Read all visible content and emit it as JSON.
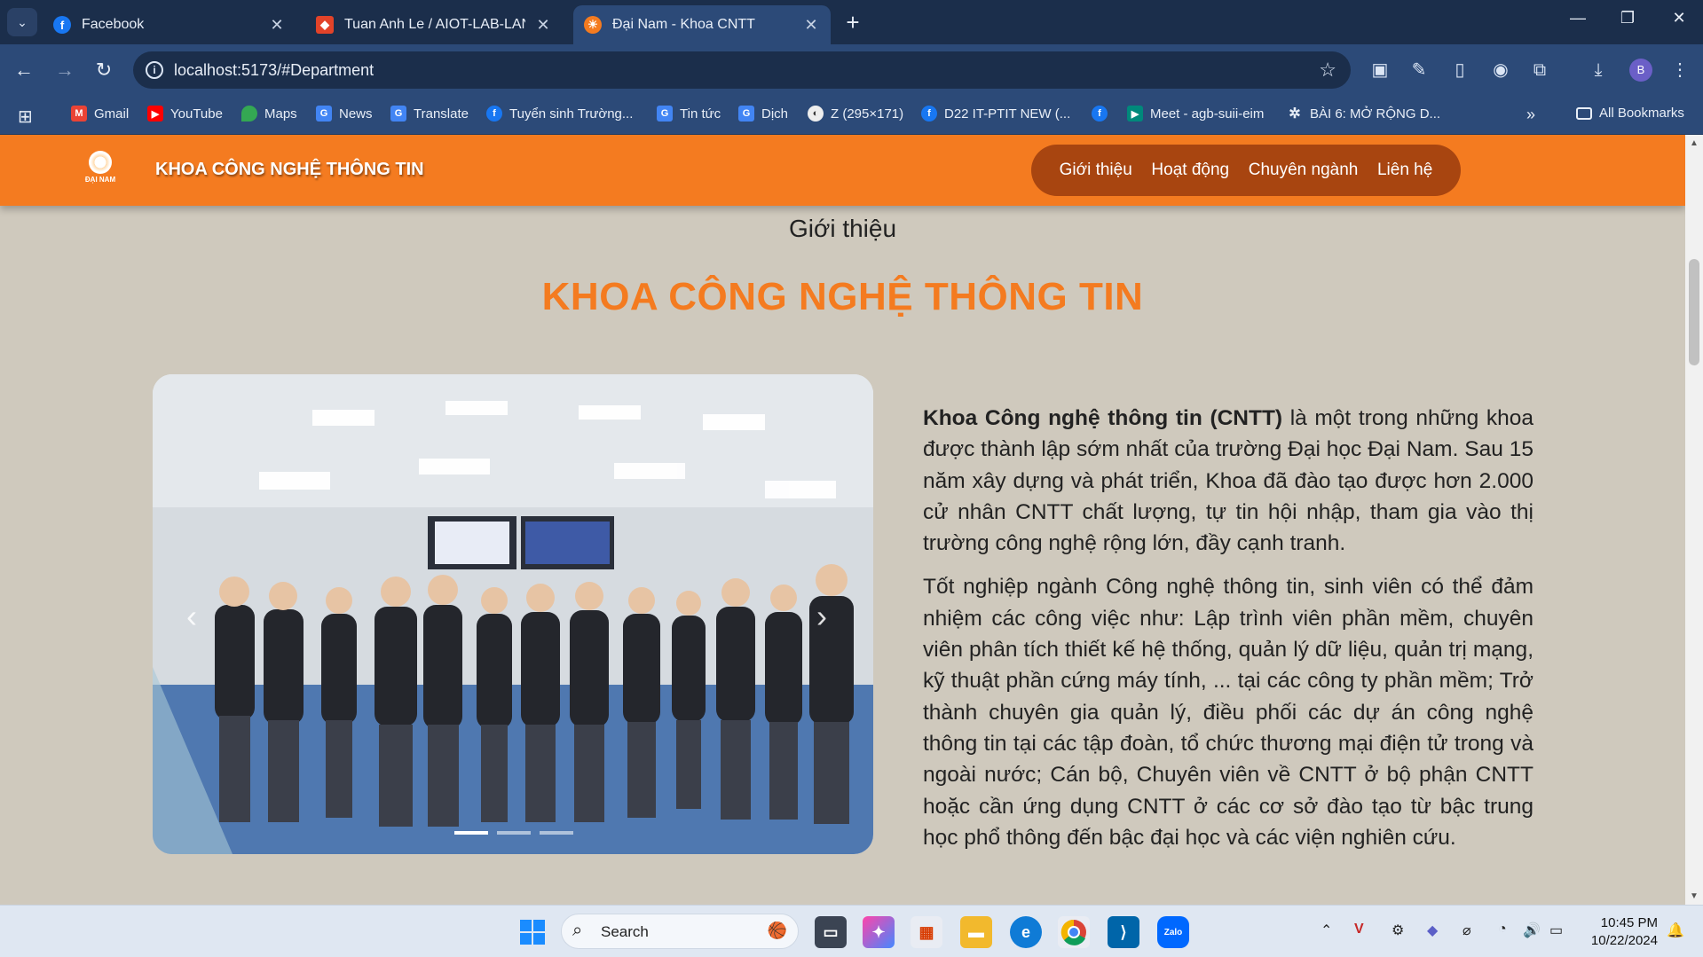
{
  "browser": {
    "tabs": [
      {
        "title": "Facebook",
        "icon": "facebook-icon",
        "color": "#1877f2"
      },
      {
        "title": "Tuan Anh Le / AIOT-LAB-LANDI",
        "icon": "gitlab-icon",
        "color": "#e24329"
      },
      {
        "title": "Đại Nam - Khoa CNTT",
        "icon": "dainam-icon",
        "color": "#f47b20"
      }
    ],
    "url": "localhost:5173/#Department",
    "bookmarks": [
      "Gmail",
      "YouTube",
      "Maps",
      "News",
      "Translate",
      "Tuyển sinh Trường...",
      "Tin tức",
      "Dịch",
      "Z (295×171)",
      "D22 IT-PTIT NEW (...",
      "",
      "Meet - agb-suii-eim",
      "BÀI 6: MỞ RỘNG D...",
      "All Bookmarks"
    ],
    "profile_initial": "B"
  },
  "site": {
    "title": "KHOA CÔNG NGHỆ THÔNG TIN",
    "logo_text": "ĐẠI NAM",
    "nav": [
      "Giới thiệu",
      "Hoạt động",
      "Chuyên ngành",
      "Liên hệ"
    ]
  },
  "section": {
    "subtitle": "Giới thiệu",
    "title": "KHOA CÔNG NGHỆ THÔNG TIN",
    "para1_bold": "Khoa Công nghệ thông tin (CNTT)",
    "para1_rest": " là một trong những khoa được thành lập sớm nhất của trường Đại học Đại Nam. Sau 15 năm xây dựng và phát triển, Khoa đã đào tạo được hơn 2.000 cử nhân CNTT chất lượng, tự tin hội nhập, tham gia vào thị trường công nghệ rộng lớn, đầy cạnh tranh.",
    "para2": "Tốt nghiệp ngành Công nghệ thông tin, sinh viên có thể đảm nhiệm các công việc như: Lập trình viên phần mềm, chuyên viên phân tích thiết kế hệ thống, quản lý dữ liệu, quản trị mạng, kỹ thuật phần cứng máy tính, ... tại các công ty phần mềm; Trở thành chuyên gia quản lý, điều phối các dự án công nghệ thông tin tại các tập đoàn, tổ chức thương mại điện tử trong và ngoài nước; Cán bộ, Chuyên viên về CNTT ở bộ phận CNTT hoặc cần ứng dụng CNTT ở các cơ sở đào tạo từ bậc trung học phổ thông đến bậc đại học và các viện nghiên cứu."
  },
  "taskbar": {
    "search_label": "Search",
    "time": "10:45 PM",
    "date": "10/22/2024"
  },
  "colors": {
    "accent": "#f47b20",
    "nav_pill": "#a84510",
    "page_bg": "#cfc9bd"
  }
}
